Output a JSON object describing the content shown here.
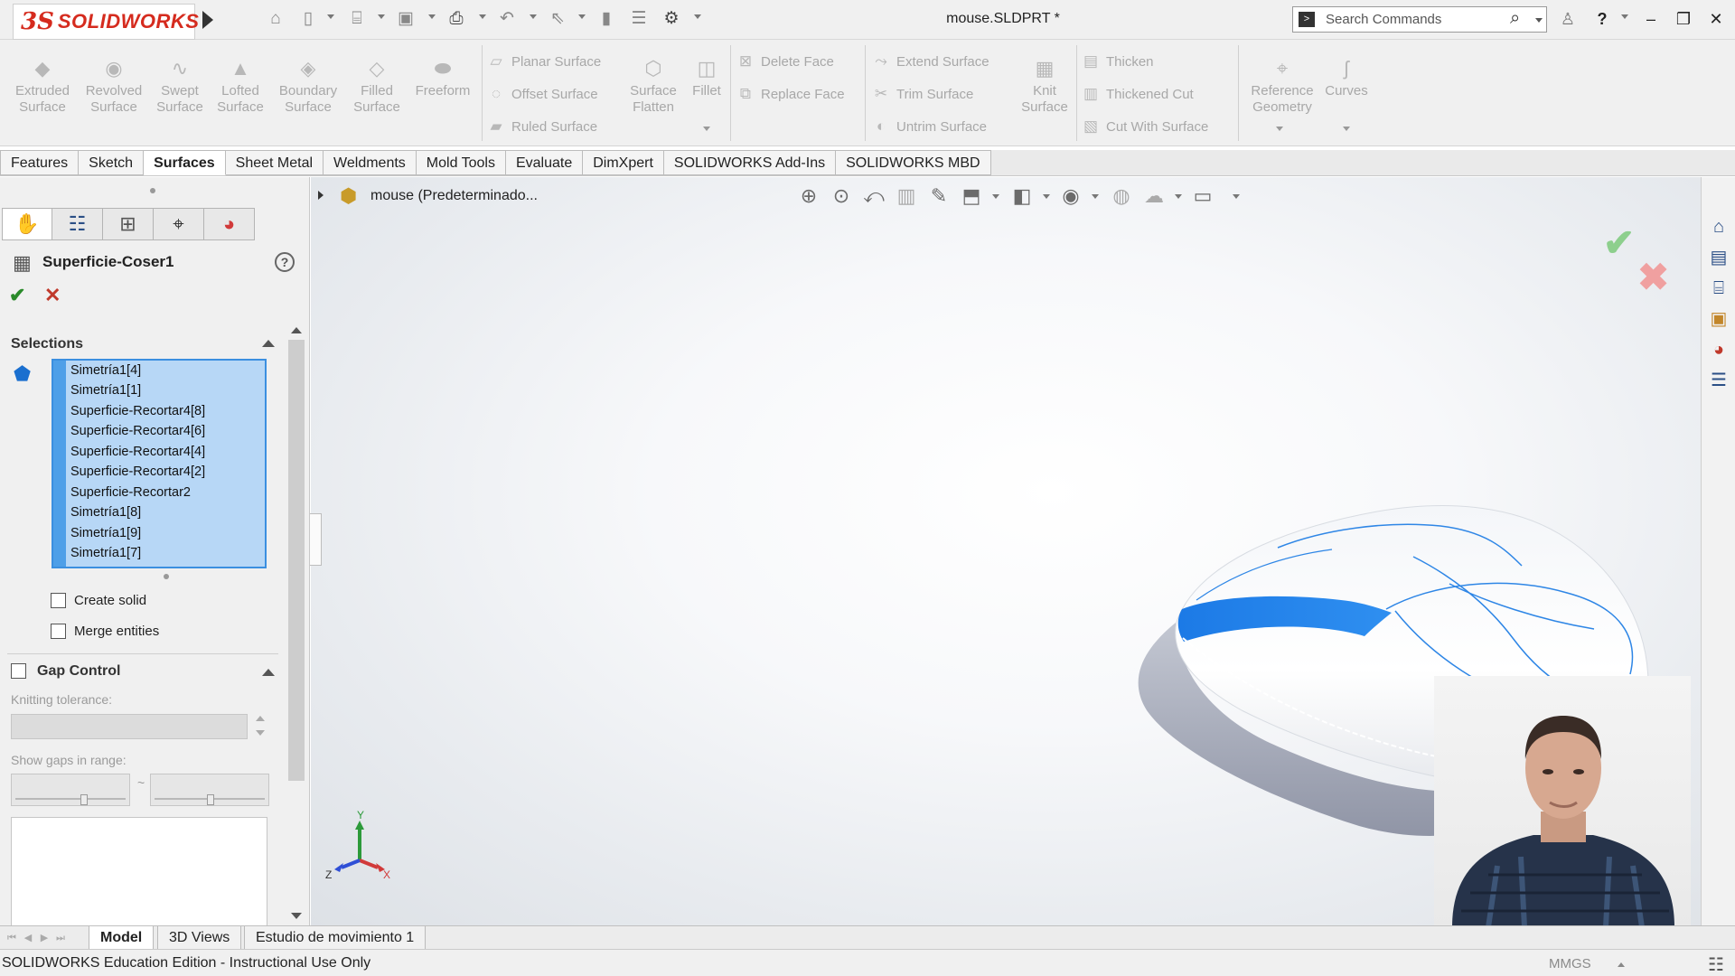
{
  "app": {
    "brand_prefix": "3S",
    "brand_name": "SOLIDWORKS",
    "document_title": "mouse.SLDPRT *"
  },
  "search": {
    "placeholder": "Search Commands"
  },
  "ribbon": {
    "big_tools": [
      {
        "line1": "Extruded",
        "line2": "Surface",
        "icon": "extruded-surface-icon"
      },
      {
        "line1": "Revolved",
        "line2": "Surface",
        "icon": "revolved-surface-icon"
      },
      {
        "line1": "Swept",
        "line2": "Surface",
        "icon": "swept-surface-icon"
      },
      {
        "line1": "Lofted",
        "line2": "Surface",
        "icon": "lofted-surface-icon"
      },
      {
        "line1": "Boundary",
        "line2": "Surface",
        "icon": "boundary-surface-icon"
      },
      {
        "line1": "Filled",
        "line2": "Surface",
        "icon": "filled-surface-icon"
      },
      {
        "line1": "Freeform",
        "line2": "",
        "icon": "freeform-icon"
      }
    ],
    "surface_group": [
      "Planar Surface",
      "Offset Surface",
      "Ruled Surface"
    ],
    "surface_flatten": {
      "line1": "Surface",
      "line2": "Flatten"
    },
    "fillet": "Fillet",
    "face_group": [
      "Delete Face",
      "Replace Face"
    ],
    "trim_group": [
      "Extend Surface",
      "Trim Surface",
      "Untrim Surface"
    ],
    "knit_surface": {
      "line1": "Knit",
      "line2": "Surface"
    },
    "thicken_group": [
      "Thicken",
      "Thickened Cut",
      "Cut With Surface"
    ],
    "reference_geometry": {
      "line1": "Reference",
      "line2": "Geometry"
    },
    "curves": "Curves"
  },
  "command_tabs": [
    "Features",
    "Sketch",
    "Surfaces",
    "Sheet Metal",
    "Weldments",
    "Mold Tools",
    "Evaluate",
    "DimXpert",
    "SOLIDWORKS Add-Ins",
    "SOLIDWORKS MBD"
  ],
  "active_command_tab": "Surfaces",
  "property_manager": {
    "title": "Superficie-Coser1",
    "help": "?",
    "selections_heading": "Selections",
    "selections": [
      "Simetría1[4]",
      "Simetría1[1]",
      "Superficie-Recortar4[8]",
      "Superficie-Recortar4[6]",
      "Superficie-Recortar4[4]",
      "Superficie-Recortar4[2]",
      "Superficie-Recortar2",
      "Simetría1[8]",
      "Simetría1[9]",
      "Simetría1[7]"
    ],
    "create_solid": "Create solid",
    "merge_entities": "Merge entities",
    "gap_control": "Gap Control",
    "knitting_tolerance": "Knitting tolerance:",
    "show_gaps_in_range": "Show gaps in range:",
    "range_separator": "~"
  },
  "viewport": {
    "tree_label": "mouse  (Predeterminado...",
    "triad": {
      "x": "X",
      "y": "Y",
      "z": "Z"
    }
  },
  "bottom_tabs": [
    "Model",
    "3D Views",
    "Estudio de movimiento 1"
  ],
  "active_bottom_tab": "Model",
  "status": {
    "text": "SOLIDWORKS Education Edition - Instructional Use Only",
    "units": "MMGS"
  },
  "colors": {
    "brand_red": "#d52b1e",
    "selection_blue": "#b7d7f6",
    "highlight_face": "#1e7fe6",
    "ok_green": "#2a8a2a",
    "cancel_red": "#c0392b"
  }
}
